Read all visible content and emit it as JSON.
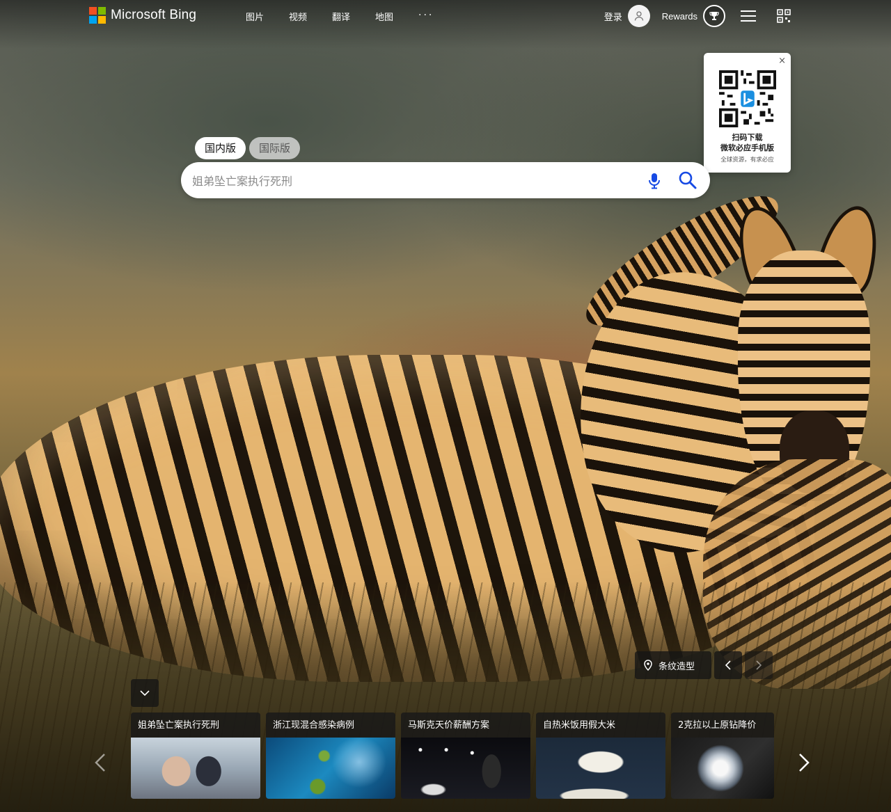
{
  "header": {
    "logo_text": "Microsoft Bing",
    "logo_colors": [
      "#f25022",
      "#7fba00",
      "#00a4ef",
      "#ffb900"
    ],
    "nav": [
      "图片",
      "视频",
      "翻译",
      "地图",
      "···"
    ],
    "login": "登录",
    "rewards": "Rewards",
    "icons": [
      "user-avatar-icon",
      "rewards-trophy-icon",
      "hamburger-menu-icon",
      "qr-code-icon"
    ]
  },
  "qr_popup": {
    "line1": "扫码下载",
    "line2": "微软必应手机版",
    "line3": "全球资源，有求必应",
    "close": "×"
  },
  "search": {
    "tabs": [
      "国内版",
      "国际版"
    ],
    "active_tab": "国内版",
    "placeholder": "姐弟坠亡案执行死刑",
    "value": ""
  },
  "image_info": {
    "location": "条纹造型"
  },
  "news": {
    "cards": [
      {
        "title": "姐弟坠亡案执行死刑"
      },
      {
        "title": "浙江现混合感染病例"
      },
      {
        "title": "马斯克天价薪酬方案"
      },
      {
        "title": "自热米饭用假大米"
      },
      {
        "title": "2克拉以上原钻降价"
      }
    ]
  }
}
